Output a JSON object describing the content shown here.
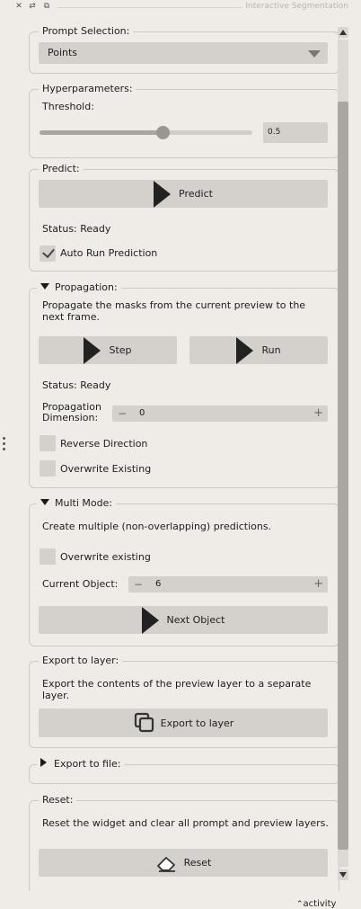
{
  "window": {
    "title": "Interactive Segmentation",
    "icons": [
      "close-icon",
      "float-icon",
      "restore-icon"
    ]
  },
  "prompt_selection": {
    "title": "Prompt Selection:",
    "selected": "Points"
  },
  "hyperparameters": {
    "title": "Hyperparameters:",
    "threshold_label": "Threshold:",
    "threshold_value": "0.5",
    "threshold_fraction": 0.58
  },
  "predict": {
    "title": "Predict:",
    "button_label": "Predict",
    "status": "Status: Ready",
    "auto_run_label": "Auto Run Prediction",
    "auto_run_checked": true
  },
  "propagation": {
    "title": "Propagation:",
    "description": "Propagate the masks from the current preview to the next frame.",
    "step_label": "Step",
    "run_label": "Run",
    "status": "Status: Ready",
    "dimension_label": "Propagation Dimension:",
    "dimension_value": "0",
    "reverse_label": "Reverse Direction",
    "overwrite_label": "Overwrite Existing"
  },
  "multi_mode": {
    "title": "Multi Mode:",
    "description": "Create multiple (non-overlapping) predictions.",
    "overwrite_label": "Overwrite existing",
    "current_object_label": "Current Object:",
    "current_object_value": "6",
    "next_object_label": "Next Object"
  },
  "export_layer": {
    "title": "Export to layer:",
    "description": "Export the contents of the preview layer to a separate layer.",
    "button_label": "Export to layer"
  },
  "export_file": {
    "title": "Export to file:"
  },
  "reset": {
    "title": "Reset:",
    "description": "Reset the widget and clear all prompt and preview layers.",
    "button_label": "Reset"
  },
  "footer": {
    "activity_label": "activity"
  }
}
